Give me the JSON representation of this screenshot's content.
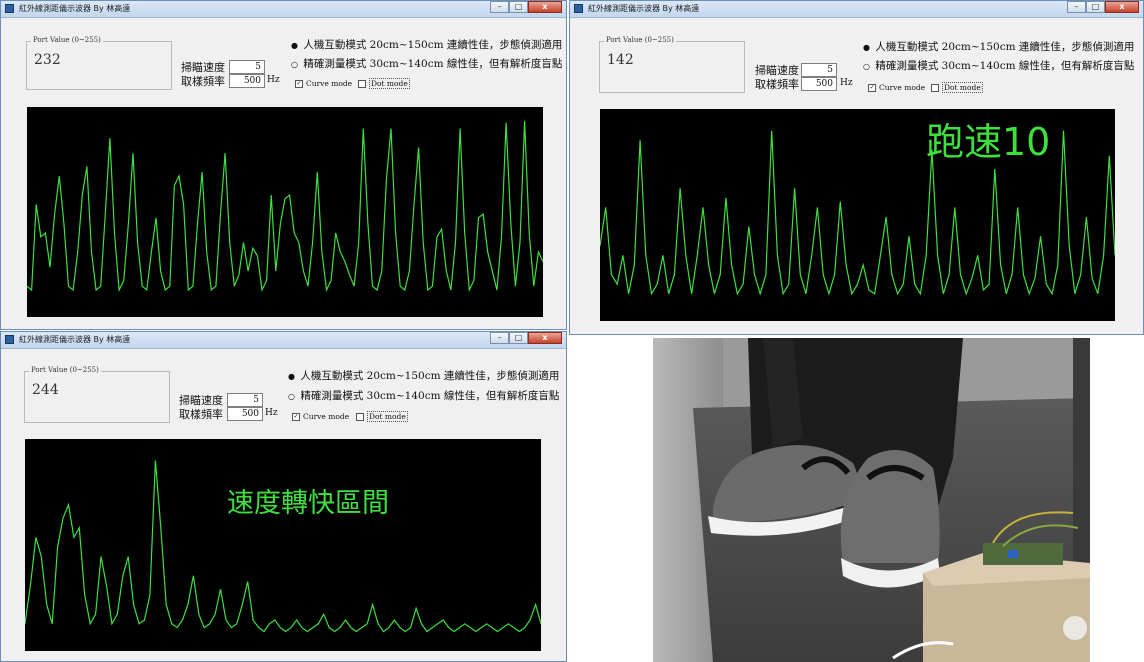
{
  "windows": [
    {
      "title": "紅外線測距儀示波器 By 林高遠",
      "controls": {
        "minimize": "–",
        "maximize": "□",
        "close": "x"
      },
      "port_label": "Port Value (0~255)",
      "port_value": "232",
      "scan_label": "掃瞄速度",
      "scan_value": "5",
      "rate_label": "取樣頻率",
      "rate_value": "500",
      "rate_unit": "Hz",
      "mode1": "人機互動模式 20cm~150cm 連續性佳，步態偵測適用",
      "mode2": "精確測量模式 30cm~140cm 線性佳，但有解析度盲點",
      "curve_mode": "Curve mode",
      "dot_mode": "Dot mode",
      "overlay": "",
      "waveform": [
        0.12,
        0.1,
        0.55,
        0.38,
        0.4,
        0.22,
        0.5,
        0.7,
        0.45,
        0.12,
        0.1,
        0.3,
        0.6,
        0.75,
        0.3,
        0.1,
        0.12,
        0.5,
        0.9,
        0.4,
        0.1,
        0.15,
        0.45,
        0.82,
        0.35,
        0.12,
        0.1,
        0.3,
        0.48,
        0.2,
        0.1,
        0.12,
        0.65,
        0.7,
        0.55,
        0.1,
        0.12,
        0.45,
        0.72,
        0.3,
        0.1,
        0.12,
        0.5,
        0.82,
        0.35,
        0.12,
        0.18,
        0.35,
        0.2,
        0.32,
        0.28,
        0.1,
        0.15,
        0.6,
        0.2,
        0.45,
        0.58,
        0.6,
        0.4,
        0.35,
        0.2,
        0.12,
        0.35,
        0.72,
        0.3,
        0.1,
        0.15,
        0.4,
        0.3,
        0.25,
        0.18,
        0.12,
        0.35,
        0.95,
        0.45,
        0.12,
        0.1,
        0.2,
        0.68,
        0.95,
        0.4,
        0.12,
        0.1,
        0.2,
        0.55,
        0.85,
        0.35,
        0.1,
        0.12,
        0.38,
        0.42,
        0.2,
        0.1,
        0.35,
        0.95,
        0.4,
        0.1,
        0.15,
        0.48,
        0.5,
        0.3,
        0.2,
        0.1,
        0.38,
        0.98,
        0.45,
        0.12,
        0.35,
        0.99,
        0.4,
        0.12,
        0.3,
        0.25
      ]
    },
    {
      "title": "紅外線測距儀示波器 By 林高遠",
      "controls": {
        "minimize": "–",
        "maximize": "□",
        "close": "x"
      },
      "port_label": "Port Value (0~255)",
      "port_value": "142",
      "scan_label": "掃瞄速度",
      "scan_value": "5",
      "rate_label": "取樣頻率",
      "rate_value": "500",
      "rate_unit": "Hz",
      "mode1": "人機互動模式 20cm~150cm 連續性佳，步態偵測適用",
      "mode2": "精確測量模式 30cm~140cm 線性佳，但有解析度盲點",
      "curve_mode": "Curve mode",
      "dot_mode": "Dot mode",
      "overlay": "跑速10",
      "waveform": [
        0.35,
        0.55,
        0.2,
        0.15,
        0.3,
        0.1,
        0.25,
        0.9,
        0.3,
        0.1,
        0.15,
        0.3,
        0.1,
        0.2,
        0.65,
        0.3,
        0.1,
        0.3,
        0.55,
        0.25,
        0.1,
        0.2,
        0.6,
        0.25,
        0.1,
        0.15,
        0.45,
        0.2,
        0.1,
        0.2,
        0.95,
        0.3,
        0.1,
        0.15,
        0.65,
        0.2,
        0.1,
        0.3,
        0.55,
        0.2,
        0.1,
        0.2,
        0.58,
        0.25,
        0.1,
        0.15,
        0.25,
        0.12,
        0.1,
        0.3,
        0.5,
        0.2,
        0.1,
        0.15,
        0.4,
        0.15,
        0.1,
        0.3,
        0.85,
        0.3,
        0.1,
        0.2,
        0.55,
        0.2,
        0.1,
        0.18,
        0.3,
        0.12,
        0.15,
        0.75,
        0.25,
        0.1,
        0.2,
        0.55,
        0.2,
        0.1,
        0.18,
        0.4,
        0.15,
        0.1,
        0.25,
        0.95,
        0.35,
        0.1,
        0.2,
        0.5,
        0.18,
        0.1,
        0.3,
        0.82,
        0.3
      ]
    },
    {
      "title": "紅外線測距儀示波器 By 林高遠",
      "controls": {
        "minimize": "–",
        "maximize": "□",
        "close": "x"
      },
      "port_label": "Port Value (0~255)",
      "port_value": "244",
      "scan_label": "掃瞄速度",
      "scan_value": "5",
      "rate_label": "取樣頻率",
      "rate_value": "500",
      "rate_unit": "Hz",
      "mode1": "人機互動模式 20cm~150cm 連續性佳，步態偵測適用",
      "mode2": "精確測量模式 30cm~140cm 線性佳，但有解析度盲點",
      "curve_mode": "Curve mode",
      "dot_mode": "Dot mode",
      "overlay": "速度轉快區間",
      "waveform": [
        0.1,
        0.3,
        0.55,
        0.45,
        0.2,
        0.1,
        0.5,
        0.65,
        0.72,
        0.55,
        0.6,
        0.25,
        0.1,
        0.15,
        0.45,
        0.3,
        0.1,
        0.15,
        0.35,
        0.45,
        0.2,
        0.1,
        0.12,
        0.25,
        0.95,
        0.6,
        0.2,
        0.1,
        0.08,
        0.12,
        0.2,
        0.35,
        0.15,
        0.08,
        0.1,
        0.15,
        0.28,
        0.12,
        0.08,
        0.1,
        0.2,
        0.32,
        0.12,
        0.08,
        0.06,
        0.1,
        0.12,
        0.08,
        0.06,
        0.08,
        0.12,
        0.08,
        0.06,
        0.08,
        0.1,
        0.15,
        0.08,
        0.06,
        0.08,
        0.12,
        0.08,
        0.06,
        0.08,
        0.1,
        0.2,
        0.1,
        0.06,
        0.08,
        0.12,
        0.08,
        0.06,
        0.08,
        0.18,
        0.1,
        0.06,
        0.08,
        0.1,
        0.12,
        0.08,
        0.06,
        0.08,
        0.1,
        0.08,
        0.06,
        0.08,
        0.1,
        0.08,
        0.06,
        0.08,
        0.1,
        0.08,
        0.06,
        0.08,
        0.12,
        0.2,
        0.1
      ]
    }
  ],
  "radio_selected": "●",
  "radio_unselected": "○",
  "checkbox_checked": "✓",
  "plot_color": "#3ee03e"
}
